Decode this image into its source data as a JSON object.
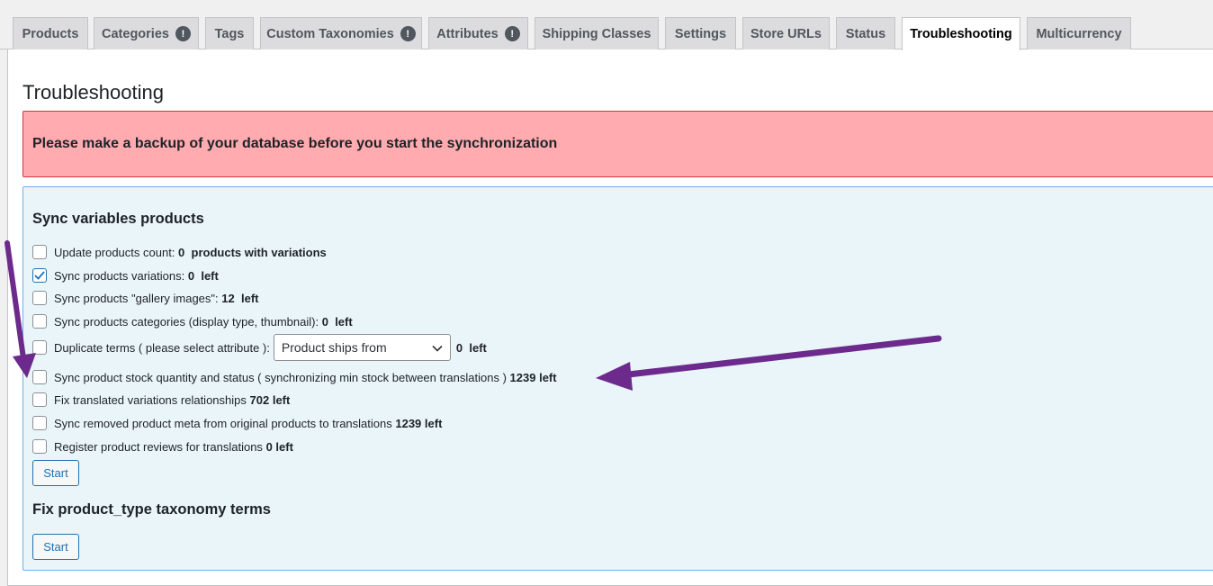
{
  "tabs": [
    {
      "label": "Products",
      "badge": ""
    },
    {
      "label": "Categories",
      "badge": "!"
    },
    {
      "label": "Tags",
      "badge": ""
    },
    {
      "label": "Custom Taxonomies",
      "badge": "!"
    },
    {
      "label": "Attributes",
      "badge": "!"
    },
    {
      "label": "Shipping Classes",
      "badge": ""
    },
    {
      "label": "Settings",
      "badge": ""
    },
    {
      "label": "Store URLs",
      "badge": ""
    },
    {
      "label": "Status",
      "badge": ""
    },
    {
      "label": "Troubleshooting",
      "badge": ""
    },
    {
      "label": "Multicurrency",
      "badge": ""
    }
  ],
  "active_tab": "Troubleshooting",
  "page": {
    "title": "Troubleshooting"
  },
  "notice": {
    "text": "Please make a backup of your database before you start the synchronization"
  },
  "sync": {
    "title": "Sync variables products",
    "options": [
      {
        "label": "Update products count:",
        "count": "0",
        "suffix": "products with variations",
        "checked": false
      },
      {
        "label": "Sync products variations:",
        "count": "0",
        "suffix": "left",
        "checked": true
      },
      {
        "label": "Sync products \"gallery images\":",
        "count": "12",
        "suffix": "left",
        "checked": false
      },
      {
        "label": "Sync products categories (display type, thumbnail):",
        "count": "0",
        "suffix": "left",
        "checked": false
      },
      {
        "label": "Duplicate terms ( please select attribute ):",
        "select_value": "Product ships from",
        "count": "0",
        "suffix": "left",
        "checked": false
      },
      {
        "label": "Sync product stock quantity and status ( synchronizing min stock between translations )",
        "count": "1239",
        "suffix": "left",
        "checked": false
      },
      {
        "label": "Fix translated variations relationships",
        "count": "702",
        "suffix": "left",
        "checked": false
      },
      {
        "label": "Sync removed product meta from original products to translations",
        "count": "1239",
        "suffix": "left",
        "checked": false
      },
      {
        "label": "Register product reviews for translations",
        "count": "0",
        "suffix": "left",
        "checked": false
      }
    ],
    "start_label": "Start"
  },
  "fix_product_type": {
    "title": "Fix product_type taxonomy terms",
    "start_label": "Start"
  },
  "colors": {
    "accent": "#2271b1",
    "notice_bg": "#ffabaf",
    "box_bg": "#eaf5fa",
    "arrow": "#6b2a8c"
  }
}
